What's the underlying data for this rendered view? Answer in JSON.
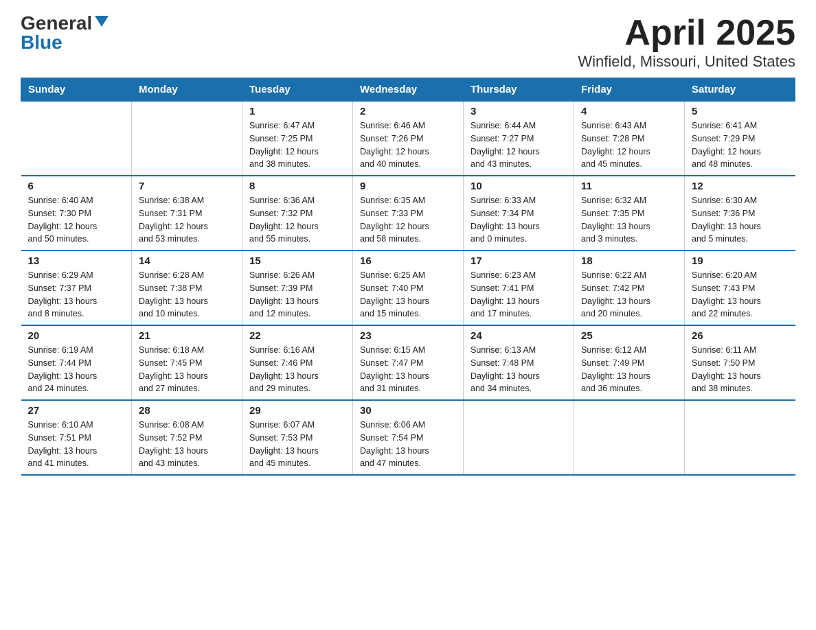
{
  "logo": {
    "general": "General",
    "blue": "Blue"
  },
  "title": "April 2025",
  "subtitle": "Winfield, Missouri, United States",
  "days_of_week": [
    "Sunday",
    "Monday",
    "Tuesday",
    "Wednesday",
    "Thursday",
    "Friday",
    "Saturday"
  ],
  "weeks": [
    [
      {
        "day": "",
        "info": ""
      },
      {
        "day": "",
        "info": ""
      },
      {
        "day": "1",
        "info": "Sunrise: 6:47 AM\nSunset: 7:25 PM\nDaylight: 12 hours\nand 38 minutes."
      },
      {
        "day": "2",
        "info": "Sunrise: 6:46 AM\nSunset: 7:26 PM\nDaylight: 12 hours\nand 40 minutes."
      },
      {
        "day": "3",
        "info": "Sunrise: 6:44 AM\nSunset: 7:27 PM\nDaylight: 12 hours\nand 43 minutes."
      },
      {
        "day": "4",
        "info": "Sunrise: 6:43 AM\nSunset: 7:28 PM\nDaylight: 12 hours\nand 45 minutes."
      },
      {
        "day": "5",
        "info": "Sunrise: 6:41 AM\nSunset: 7:29 PM\nDaylight: 12 hours\nand 48 minutes."
      }
    ],
    [
      {
        "day": "6",
        "info": "Sunrise: 6:40 AM\nSunset: 7:30 PM\nDaylight: 12 hours\nand 50 minutes."
      },
      {
        "day": "7",
        "info": "Sunrise: 6:38 AM\nSunset: 7:31 PM\nDaylight: 12 hours\nand 53 minutes."
      },
      {
        "day": "8",
        "info": "Sunrise: 6:36 AM\nSunset: 7:32 PM\nDaylight: 12 hours\nand 55 minutes."
      },
      {
        "day": "9",
        "info": "Sunrise: 6:35 AM\nSunset: 7:33 PM\nDaylight: 12 hours\nand 58 minutes."
      },
      {
        "day": "10",
        "info": "Sunrise: 6:33 AM\nSunset: 7:34 PM\nDaylight: 13 hours\nand 0 minutes."
      },
      {
        "day": "11",
        "info": "Sunrise: 6:32 AM\nSunset: 7:35 PM\nDaylight: 13 hours\nand 3 minutes."
      },
      {
        "day": "12",
        "info": "Sunrise: 6:30 AM\nSunset: 7:36 PM\nDaylight: 13 hours\nand 5 minutes."
      }
    ],
    [
      {
        "day": "13",
        "info": "Sunrise: 6:29 AM\nSunset: 7:37 PM\nDaylight: 13 hours\nand 8 minutes."
      },
      {
        "day": "14",
        "info": "Sunrise: 6:28 AM\nSunset: 7:38 PM\nDaylight: 13 hours\nand 10 minutes."
      },
      {
        "day": "15",
        "info": "Sunrise: 6:26 AM\nSunset: 7:39 PM\nDaylight: 13 hours\nand 12 minutes."
      },
      {
        "day": "16",
        "info": "Sunrise: 6:25 AM\nSunset: 7:40 PM\nDaylight: 13 hours\nand 15 minutes."
      },
      {
        "day": "17",
        "info": "Sunrise: 6:23 AM\nSunset: 7:41 PM\nDaylight: 13 hours\nand 17 minutes."
      },
      {
        "day": "18",
        "info": "Sunrise: 6:22 AM\nSunset: 7:42 PM\nDaylight: 13 hours\nand 20 minutes."
      },
      {
        "day": "19",
        "info": "Sunrise: 6:20 AM\nSunset: 7:43 PM\nDaylight: 13 hours\nand 22 minutes."
      }
    ],
    [
      {
        "day": "20",
        "info": "Sunrise: 6:19 AM\nSunset: 7:44 PM\nDaylight: 13 hours\nand 24 minutes."
      },
      {
        "day": "21",
        "info": "Sunrise: 6:18 AM\nSunset: 7:45 PM\nDaylight: 13 hours\nand 27 minutes."
      },
      {
        "day": "22",
        "info": "Sunrise: 6:16 AM\nSunset: 7:46 PM\nDaylight: 13 hours\nand 29 minutes."
      },
      {
        "day": "23",
        "info": "Sunrise: 6:15 AM\nSunset: 7:47 PM\nDaylight: 13 hours\nand 31 minutes."
      },
      {
        "day": "24",
        "info": "Sunrise: 6:13 AM\nSunset: 7:48 PM\nDaylight: 13 hours\nand 34 minutes."
      },
      {
        "day": "25",
        "info": "Sunrise: 6:12 AM\nSunset: 7:49 PM\nDaylight: 13 hours\nand 36 minutes."
      },
      {
        "day": "26",
        "info": "Sunrise: 6:11 AM\nSunset: 7:50 PM\nDaylight: 13 hours\nand 38 minutes."
      }
    ],
    [
      {
        "day": "27",
        "info": "Sunrise: 6:10 AM\nSunset: 7:51 PM\nDaylight: 13 hours\nand 41 minutes."
      },
      {
        "day": "28",
        "info": "Sunrise: 6:08 AM\nSunset: 7:52 PM\nDaylight: 13 hours\nand 43 minutes."
      },
      {
        "day": "29",
        "info": "Sunrise: 6:07 AM\nSunset: 7:53 PM\nDaylight: 13 hours\nand 45 minutes."
      },
      {
        "day": "30",
        "info": "Sunrise: 6:06 AM\nSunset: 7:54 PM\nDaylight: 13 hours\nand 47 minutes."
      },
      {
        "day": "",
        "info": ""
      },
      {
        "day": "",
        "info": ""
      },
      {
        "day": "",
        "info": ""
      }
    ]
  ]
}
